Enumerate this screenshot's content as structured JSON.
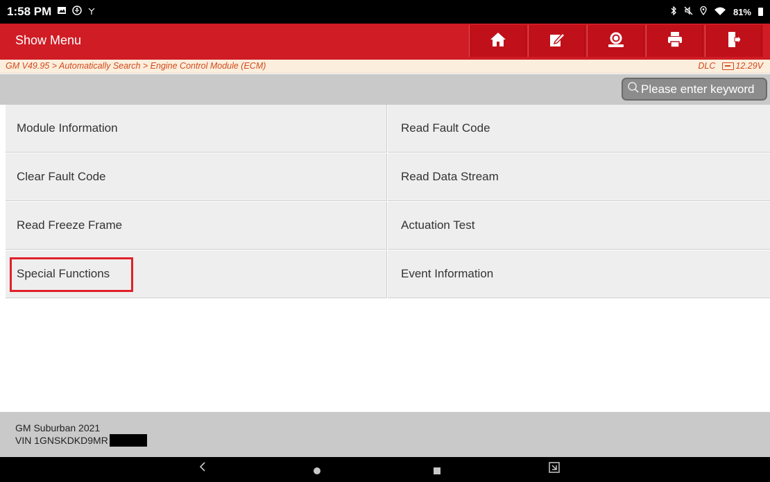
{
  "status": {
    "time": "1:58 PM",
    "battery": "81%"
  },
  "header": {
    "title": "Show Menu",
    "toolbar": [
      "home-icon",
      "edit-report-icon",
      "support-icon",
      "print-icon",
      "exit-icon"
    ]
  },
  "breadcrumb": {
    "path": "GM V49.95 > Automatically Search > Engine Control Module (ECM)",
    "connector": "DLC",
    "voltage": "12.29V"
  },
  "search": {
    "placeholder": "Please enter keyword"
  },
  "menu": {
    "items": [
      {
        "label": "Module Information"
      },
      {
        "label": "Read Fault Code"
      },
      {
        "label": "Clear Fault Code"
      },
      {
        "label": "Read Data Stream"
      },
      {
        "label": "Read Freeze Frame"
      },
      {
        "label": "Actuation Test"
      },
      {
        "label": "Special Functions"
      },
      {
        "label": "Event Information"
      }
    ],
    "highlighted_item": "Special Functions"
  },
  "vehicle": {
    "model": "GM Suburban 2021",
    "vin": "VIN 1GNSKDKD9MR"
  },
  "colors": {
    "brand_red": "#d01c25",
    "breadcrumb_text": "#d24a1a",
    "highlight_border": "#e0202a"
  }
}
